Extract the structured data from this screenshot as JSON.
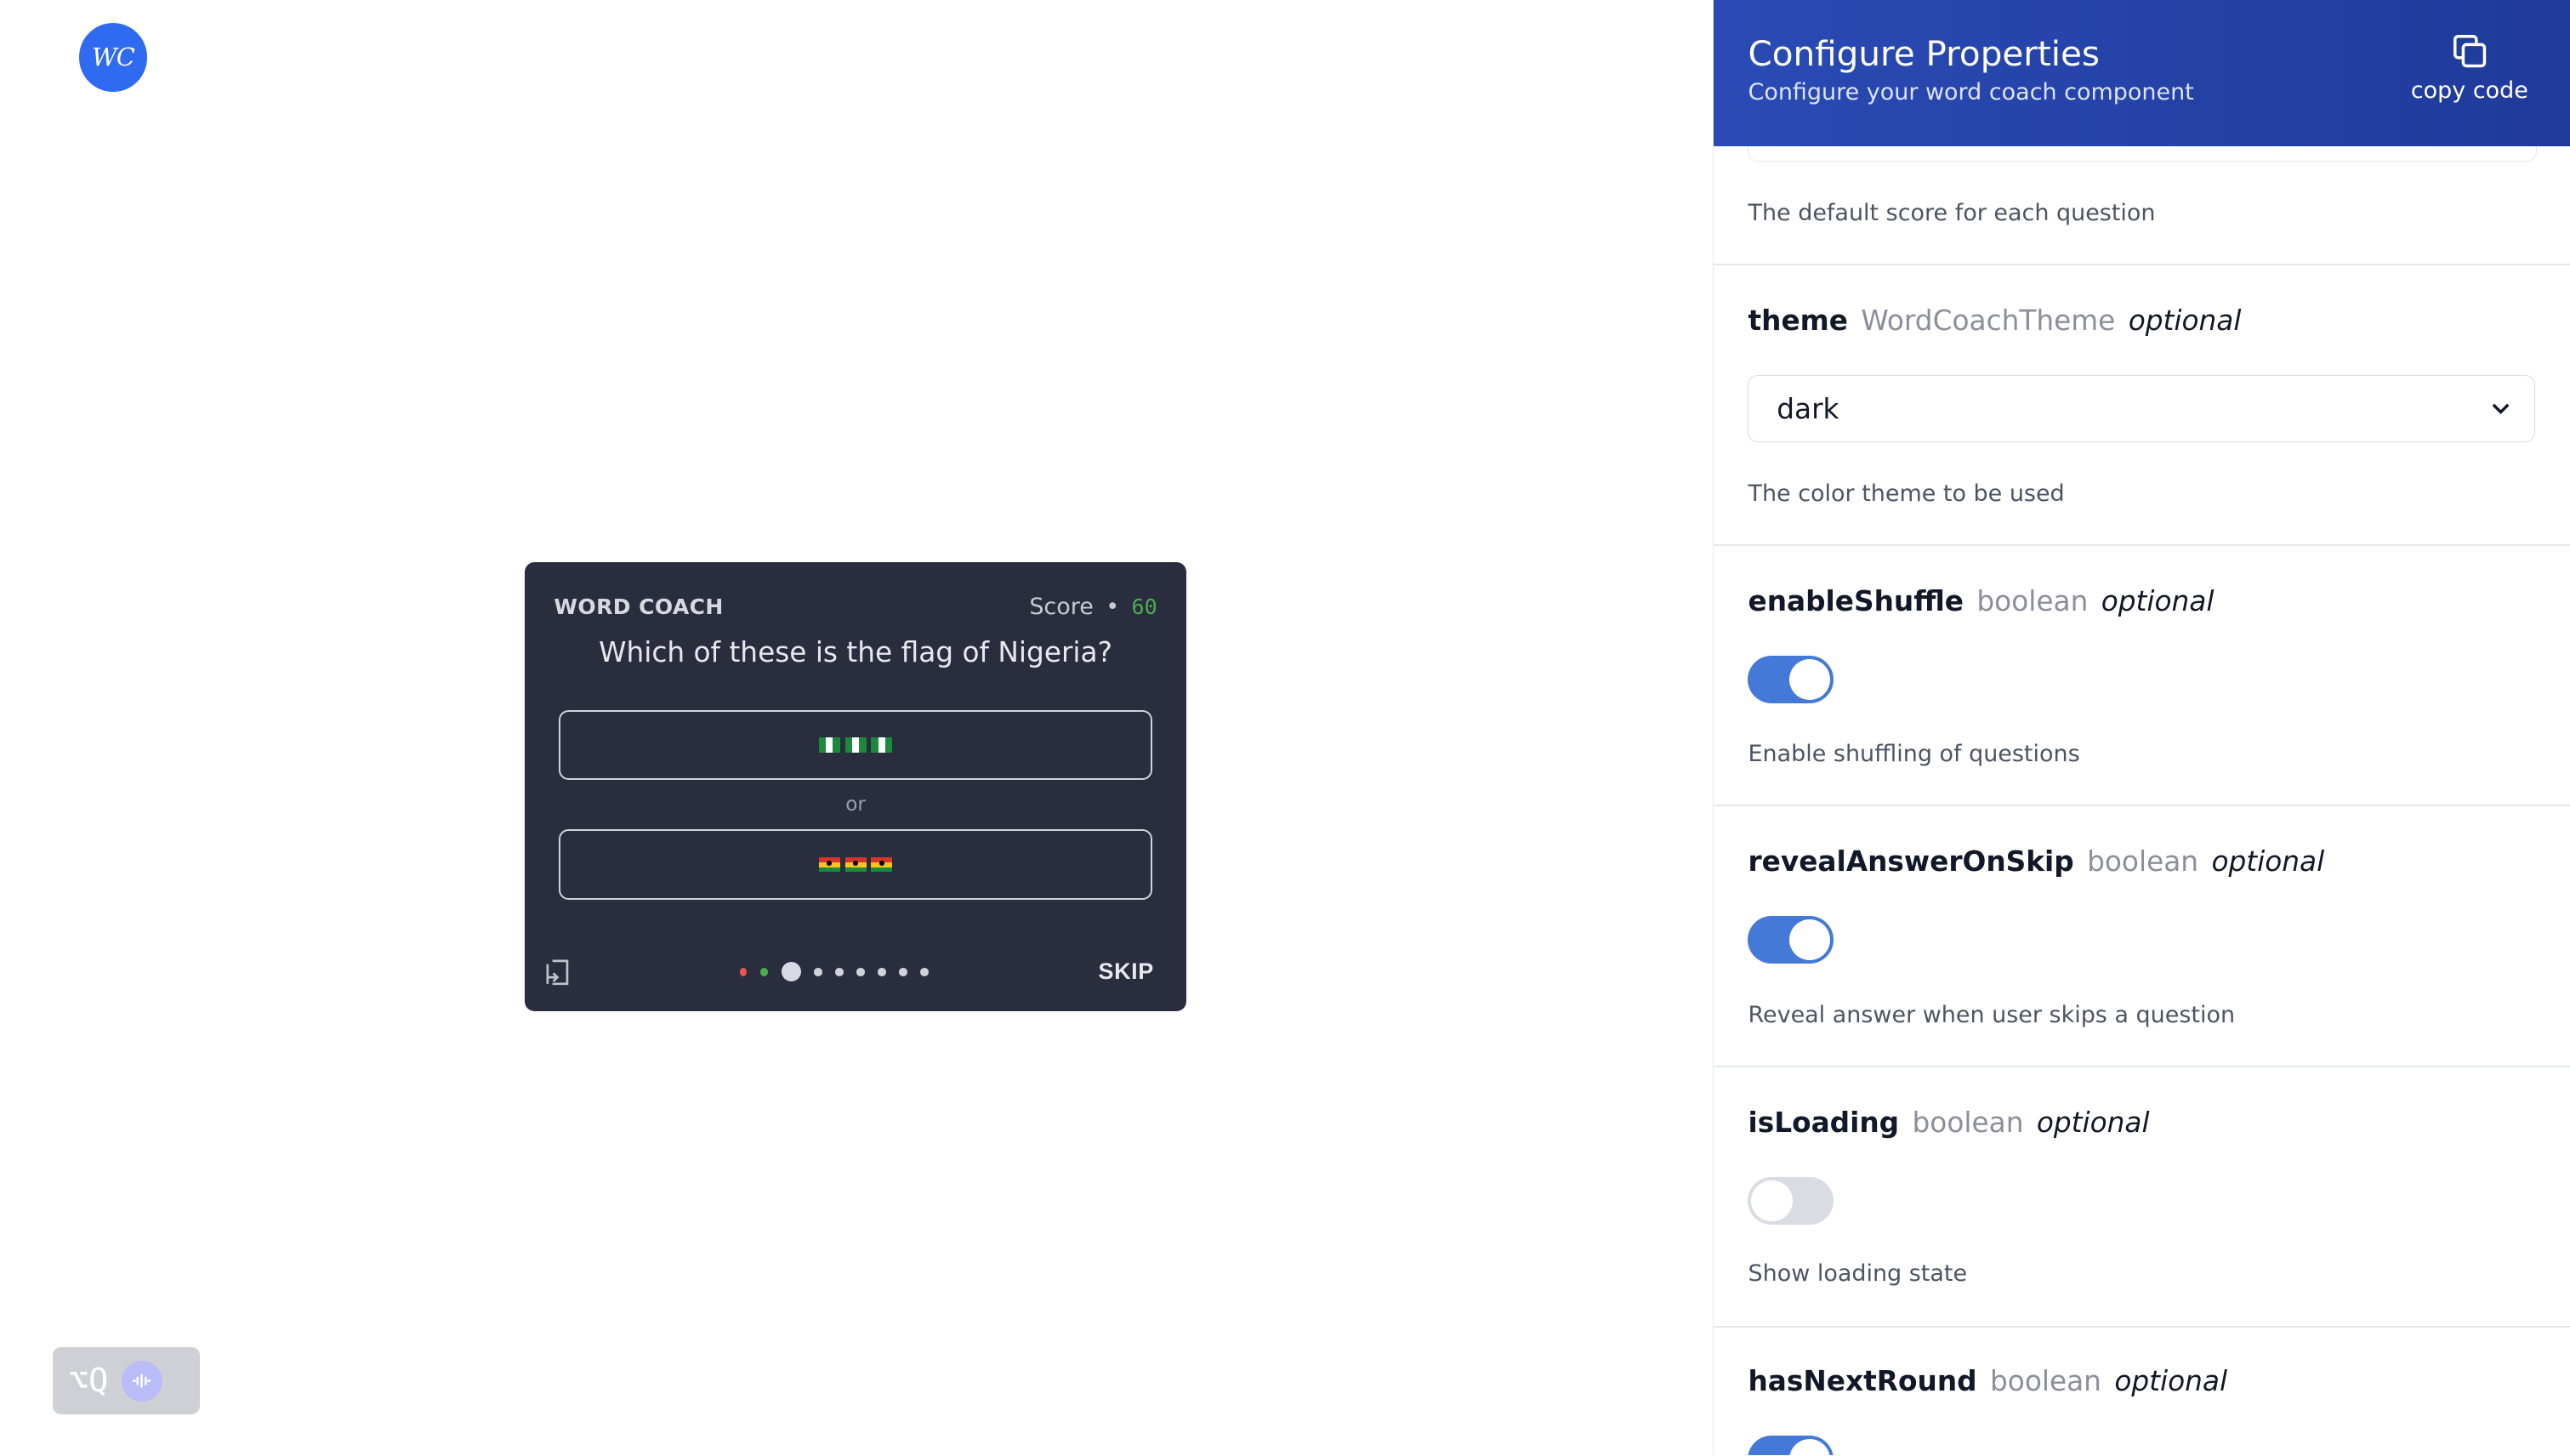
{
  "logo": {
    "text": "WC"
  },
  "word_coach": {
    "brand": "WORD COACH",
    "score_label": "Score",
    "score_separator": "•",
    "score_value": "60",
    "question": "Which of these is the flag of Nigeria?",
    "option_1": {
      "icon": "nigeria-flag-icon",
      "count": 3
    },
    "or_label": "or",
    "option_2": {
      "icon": "ghana-flag-icon",
      "count": 3
    },
    "skip_label": "SKIP",
    "progress": {
      "answered": [
        "wrong",
        "correct"
      ],
      "current_index": 2,
      "total": 9
    }
  },
  "keyboard_hint": {
    "text": "⌥Q"
  },
  "panel": {
    "title": "Configure Properties",
    "subtitle": "Configure your word coach component",
    "copy_label": "copy code",
    "properties": [
      {
        "description": "The default score for each question"
      },
      {
        "name": "theme",
        "type": "WordCoachTheme",
        "optional": "optional",
        "value": "dark",
        "description": "The color theme to be used"
      },
      {
        "name": "enableShuffle",
        "type": "boolean",
        "optional": "optional",
        "value": true,
        "description": "Enable shuffling of questions"
      },
      {
        "name": "revealAnswerOnSkip",
        "type": "boolean",
        "optional": "optional",
        "value": true,
        "description": "Reveal answer when user skips a question"
      },
      {
        "name": "isLoading",
        "type": "boolean",
        "optional": "optional",
        "value": false,
        "description": "Show loading state"
      },
      {
        "name": "hasNextRound",
        "type": "boolean",
        "optional": "optional",
        "value": true
      }
    ]
  },
  "colors": {
    "card_bg": "#2a2d3d",
    "panel_header": "#2a4bb5",
    "toggle_on": "#4579d8",
    "toggle_off": "#d9dce3",
    "score_value": "#4caf50"
  }
}
